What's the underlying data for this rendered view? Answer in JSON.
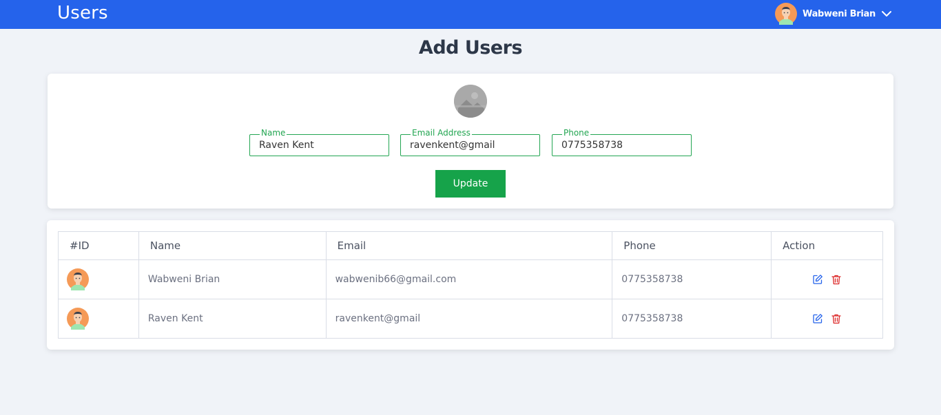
{
  "header": {
    "title": "Users",
    "user_name": "Wabweni Brian",
    "user_avatar_icon": "avatar-icon",
    "menu_icon": "chevron-down-icon"
  },
  "page": {
    "title": "Add Users"
  },
  "form": {
    "photo_icon": "image-placeholder-icon",
    "name_label": "Name",
    "name_value": "Raven Kent",
    "email_label": "Email Address",
    "email_value": "ravenkent@gmail",
    "phone_label": "Phone",
    "phone_value": "0775358738",
    "submit_label": "Update"
  },
  "table": {
    "headers": [
      "#ID",
      "Name",
      "Email",
      "Phone",
      "Action"
    ],
    "rows": [
      {
        "name": "Wabweni Brian",
        "email": "wabwenib66@gmail.com",
        "phone": "0775358738"
      },
      {
        "name": "Raven Kent",
        "email": "ravenkent@gmail",
        "phone": "0775358738"
      }
    ],
    "edit_icon": "edit-icon",
    "delete_icon": "trash-icon"
  },
  "colors": {
    "header_bg": "#2563eb",
    "accent_green": "#16a34a",
    "edit_blue": "#2563eb",
    "delete_red": "#dc2626"
  }
}
